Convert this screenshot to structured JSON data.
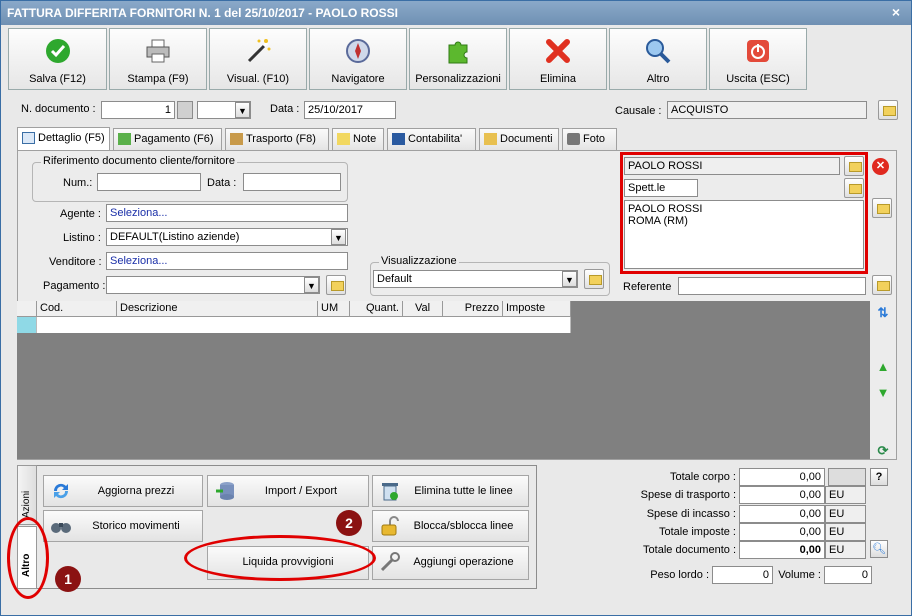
{
  "window": {
    "title": "FATTURA DIFFERITA FORNITORI N. 1 del 25/10/2017 - PAOLO ROSSI",
    "close": "×"
  },
  "toolbar": [
    {
      "label": "Salva (F12)",
      "icon": "save-check-icon"
    },
    {
      "label": "Stampa (F9)",
      "icon": "printer-icon"
    },
    {
      "label": "Visual. (F10)",
      "icon": "magic-wand-icon"
    },
    {
      "label": "Navigatore",
      "icon": "compass-icon"
    },
    {
      "label": "Personalizzazioni",
      "icon": "puzzle-icon"
    },
    {
      "label": "Elimina",
      "icon": "delete-x-icon"
    },
    {
      "label": "Altro",
      "icon": "magnifier-icon"
    },
    {
      "label": "Uscita (ESC)",
      "icon": "power-icon"
    }
  ],
  "header": {
    "n_documento_label": "N. documento :",
    "n_documento_value": "1",
    "data_label": "Data :",
    "data_value": "25/10/2017",
    "causale_label": "Causale :",
    "causale_value": "ACQUISTO"
  },
  "tabs": [
    {
      "label": "Dettaglio (F5)",
      "icon": "calendar-icon"
    },
    {
      "label": "Pagamento (F6)",
      "icon": "money-icon"
    },
    {
      "label": "Trasporto (F8)",
      "icon": "truck-icon"
    },
    {
      "label": "Note",
      "icon": "note-icon"
    },
    {
      "label": "Contabilita'",
      "icon": "book-icon"
    },
    {
      "label": "Documenti",
      "icon": "documents-icon"
    },
    {
      "label": "Foto",
      "icon": "camera-icon"
    }
  ],
  "riferimento": {
    "title": "Riferimento documento cliente/fornitore",
    "num_label": "Num.:",
    "num_value": "",
    "data_label": "Data :",
    "data_value": ""
  },
  "fields": {
    "agente_label": "Agente :",
    "agente_value": "Seleziona...",
    "listino_label": "Listino :",
    "listino_value": "DEFAULT(Listino aziende)",
    "venditore_label": "Venditore :",
    "venditore_value": "Seleziona...",
    "pagamento_label": "Pagamento :",
    "pagamento_value": "",
    "visualizzazione_label": "Visualizzazione",
    "visualizzazione_value": "Default"
  },
  "customer": {
    "name": "PAOLO ROSSI",
    "title": "Spett.le",
    "address_line1": "PAOLO ROSSI",
    "address_line2": "ROMA (RM)",
    "referente_label": "Referente",
    "referente_value": ""
  },
  "grid": {
    "columns": [
      "Cod.",
      "Descrizione",
      "UM",
      "Quant.",
      "Val",
      "Prezzo",
      "Imposte"
    ]
  },
  "actions": {
    "vtabs": [
      "Azioni",
      "Altro"
    ],
    "buttons": [
      {
        "label": "Aggiorna prezzi",
        "icon": "refresh-icon"
      },
      {
        "label": "Import / Export",
        "icon": "database-icon"
      },
      {
        "label": "Elimina tutte le linee",
        "icon": "trash-icon"
      },
      {
        "label": "Storico movimenti",
        "icon": "binoculars-icon"
      },
      {
        "label": "Blocca/sblocca linee",
        "icon": "lock-icon"
      },
      {
        "label": "Liquida provvigioni",
        "icon": ""
      },
      {
        "label": "Aggiungi operazione",
        "icon": "tools-icon"
      }
    ],
    "badge1": "1",
    "badge2": "2"
  },
  "totals": {
    "corpo_label": "Totale corpo :",
    "corpo_value": "0,00",
    "trasporto_label": "Spese di trasporto :",
    "trasporto_value": "0,00",
    "trasporto_cur": "EU",
    "incasso_label": "Spese di incasso :",
    "incasso_value": "0,00",
    "incasso_cur": "EU",
    "imposte_label": "Totale imposte :",
    "imposte_value": "0,00",
    "imposte_cur": "EU",
    "documento_label": "Totale documento :",
    "documento_value": "0,00",
    "documento_cur": "EU",
    "peso_label": "Peso lordo :",
    "peso_value": "0",
    "volume_label": "Volume :",
    "volume_value": "0",
    "help": "?"
  }
}
